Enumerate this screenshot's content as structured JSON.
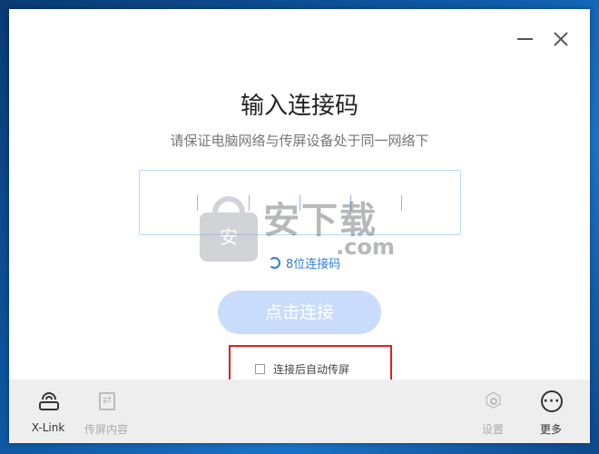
{
  "window": {
    "title": "输入连接码",
    "subtitle": "请保证电脑网络与传屏设备处于同一网络下"
  },
  "code_input": {
    "value": "",
    "slots": 6
  },
  "code_type_link": {
    "label": "8位连接码",
    "icon": "swap-icon"
  },
  "connect_button": {
    "label": "点击连接",
    "color": "#c9dcfb"
  },
  "auto_cast": {
    "label": "连接后自动传屏",
    "checked": false
  },
  "bottom_nav": {
    "items": [
      {
        "label": "X-Link",
        "icon": "router-icon",
        "enabled": true
      },
      {
        "label": "传屏内容",
        "icon": "cast-content-icon",
        "enabled": false
      },
      {
        "label": "设置",
        "icon": "settings-icon",
        "enabled": false
      },
      {
        "label": "更多",
        "icon": "more-icon",
        "enabled": true
      }
    ]
  },
  "watermark": {
    "text": "安下载",
    "domain": ".com",
    "badge": "安"
  },
  "colors": {
    "accent": "#2f7de1",
    "highlight": "#e02020",
    "bottom_bar": "#eeeeee"
  }
}
